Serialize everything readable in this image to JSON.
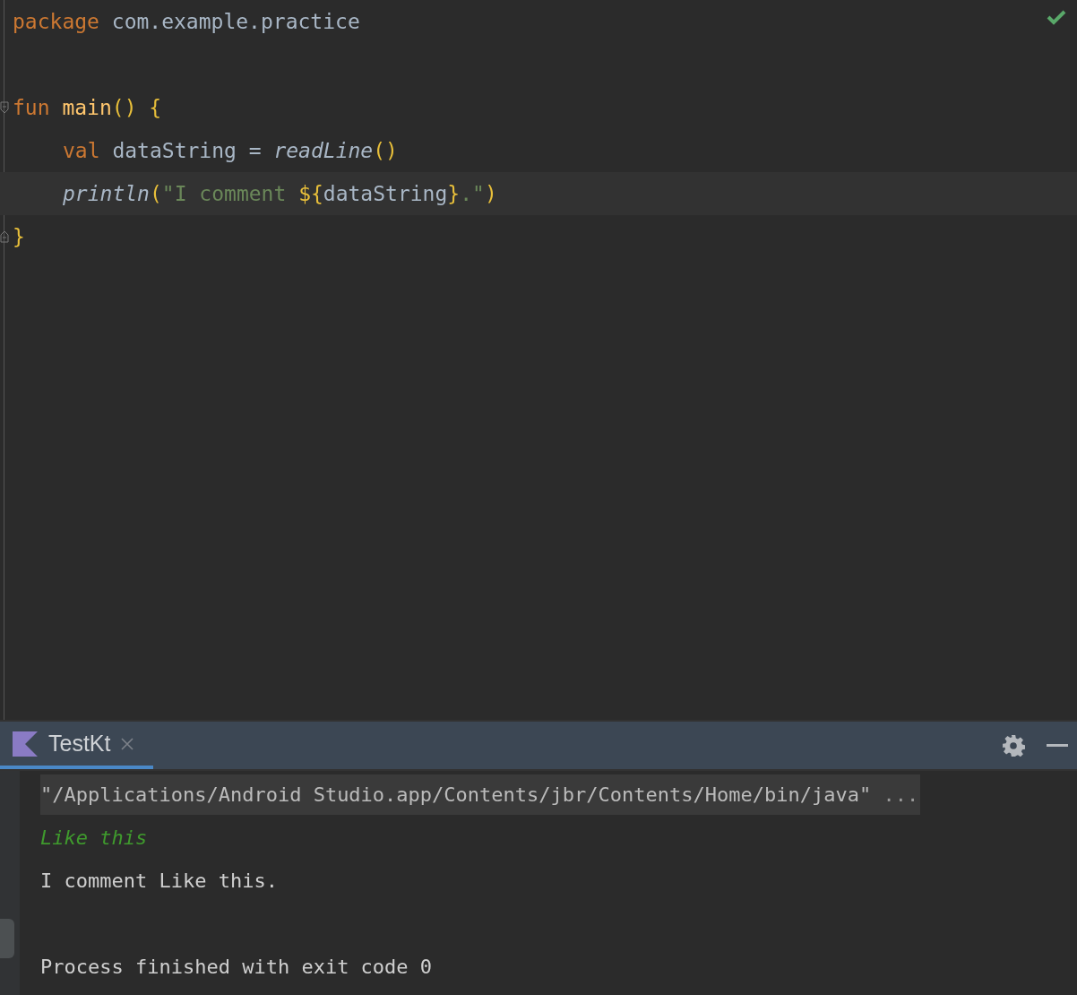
{
  "editor": {
    "lines": [
      {
        "kind": "code",
        "current": false,
        "tokens": [
          {
            "text": "package",
            "kind": "keyword"
          },
          {
            "text": " com.example.practice",
            "kind": "plain"
          }
        ]
      },
      {
        "kind": "blank",
        "current": false
      },
      {
        "kind": "code",
        "current": false,
        "fold_start": true,
        "tokens": [
          {
            "text": "fun ",
            "kind": "keyword"
          },
          {
            "text": "main",
            "kind": "function"
          },
          {
            "text": "() {",
            "kind": "brace"
          }
        ],
        "children": [
          {
            "kind": "code",
            "current": false,
            "tokens": [
              {
                "text": "val",
                "kind": "keyword"
              },
              {
                "text": " dataString = ",
                "kind": "plain"
              },
              {
                "text": "readLine",
                "kind": "call"
              },
              {
                "text": "()",
                "kind": "brace"
              }
            ]
          },
          {
            "kind": "code",
            "current": true,
            "tokens": [
              {
                "text": "println",
                "kind": "call"
              },
              {
                "text": "(",
                "kind": "brace"
              },
              {
                "text": "\"I comment ",
                "kind": "string"
              },
              {
                "text": "${",
                "kind": "brace"
              },
              {
                "text": "dataString",
                "kind": "plain"
              },
              {
                "text": "}",
                "kind": "brace"
              },
              {
                "text": ".\"",
                "kind": "string"
              },
              {
                "text": ")",
                "kind": "brace"
              }
            ]
          }
        ]
      },
      {
        "kind": "code",
        "current": false,
        "fold_end": true,
        "tokens": [
          {
            "text": "}",
            "kind": "brace"
          }
        ]
      }
    ]
  },
  "run_panel": {
    "tabs": [
      {
        "label": "TestKt",
        "selected": true,
        "closable": true
      }
    ],
    "console": [
      {
        "kind": "command",
        "text": "\"/Applications/Android Studio.app/Contents/jbr/Contents/Home/bin/java\"",
        "folded": " ..."
      },
      {
        "kind": "input",
        "text": "Like this"
      },
      {
        "kind": "output",
        "text": "I comment Like this."
      },
      {
        "kind": "blank"
      },
      {
        "kind": "output",
        "text": "Process finished with exit code 0"
      }
    ]
  }
}
